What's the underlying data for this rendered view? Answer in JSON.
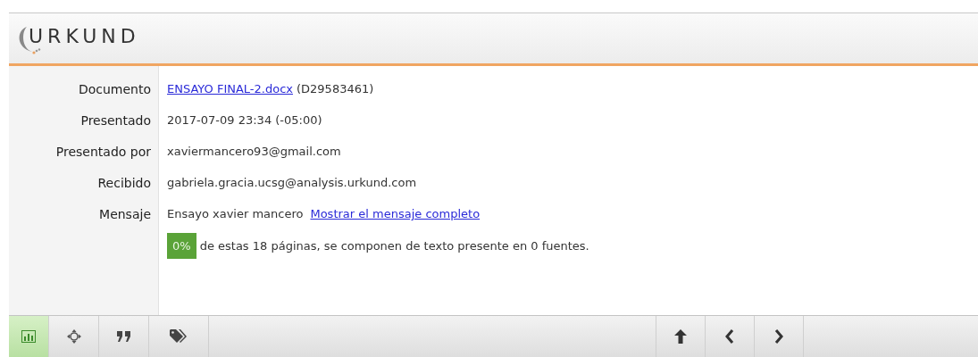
{
  "header": {
    "logo": "URKUND"
  },
  "details": [
    {
      "label": "Documento",
      "kind": "document",
      "link": "ENSAYO FINAL-2.docx",
      "value": "(D29583461)"
    },
    {
      "label": "Presentado",
      "kind": "text",
      "value": "2017-07-09 23:34 (-05:00)"
    },
    {
      "label": "Presentado por",
      "kind": "text",
      "value": "xaviermancero93@gmail.com"
    },
    {
      "label": "Recibido",
      "kind": "text",
      "value": "gabriela.gracia.ucsg@analysis.urkund.com"
    },
    {
      "label": "Mensaje",
      "kind": "message",
      "value": "Ensayo xavier mancero",
      "link": "Mostrar el mensaje completo"
    }
  ],
  "summary": {
    "percent": "0%",
    "text": "de estas 18 páginas, se componen de texto presente en 0 fuentes."
  },
  "toolbar": {
    "tools": [
      {
        "kind": "chart",
        "selected": true
      },
      {
        "kind": "target",
        "selected": false
      },
      {
        "kind": "quote",
        "selected": false
      },
      {
        "kind": "tags",
        "selected": false
      }
    ],
    "nav": [
      {
        "kind": "up"
      },
      {
        "kind": "prev"
      },
      {
        "kind": "next"
      }
    ]
  }
}
